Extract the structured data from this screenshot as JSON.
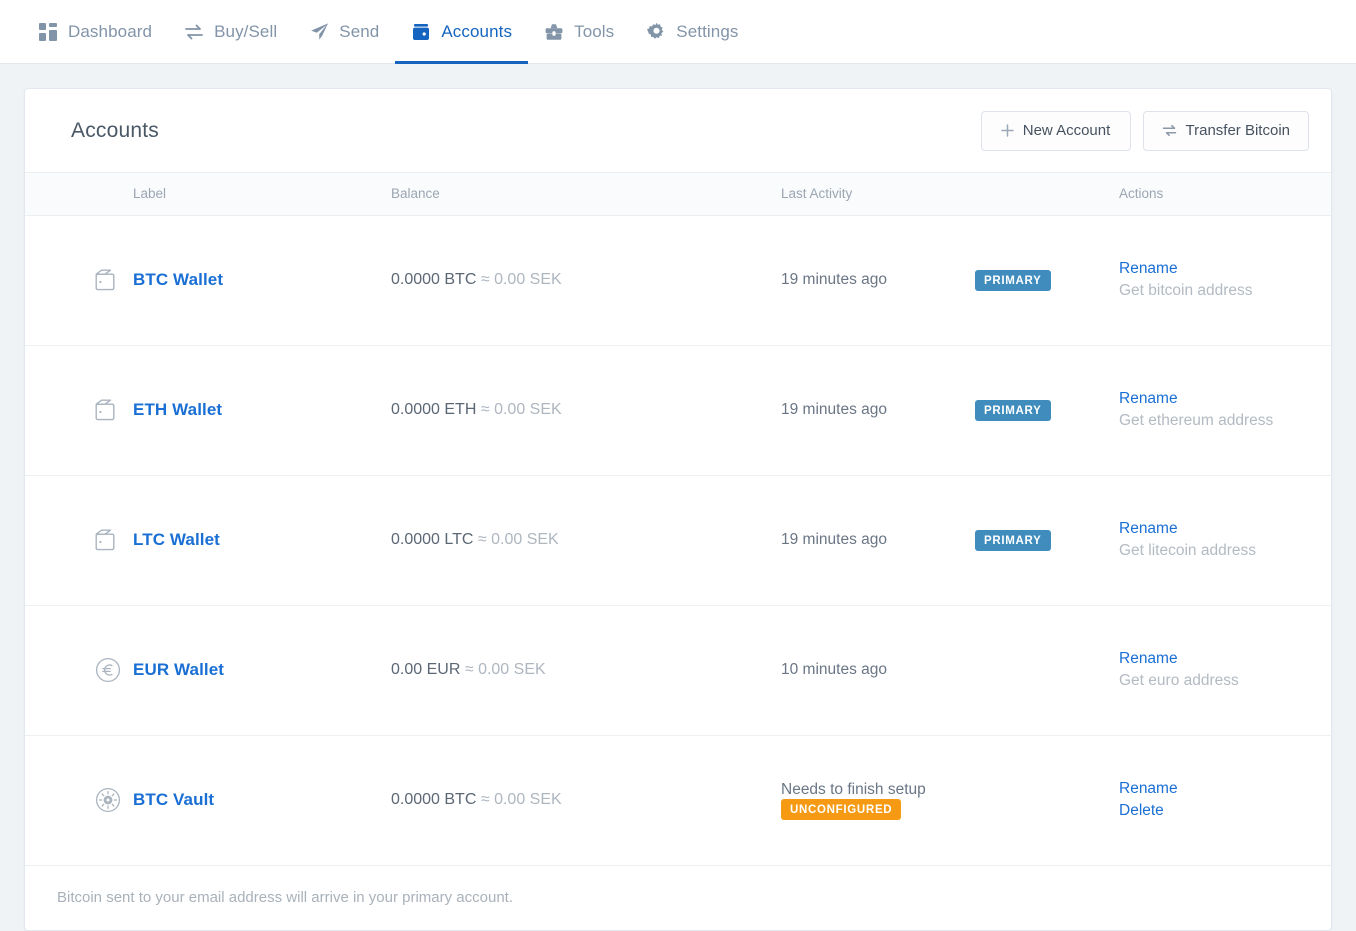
{
  "nav": {
    "items": [
      {
        "label": "Dashboard",
        "icon": "grid-icon",
        "active": false
      },
      {
        "label": "Buy/Sell",
        "icon": "exchange-icon",
        "active": false
      },
      {
        "label": "Send",
        "icon": "paper-plane-icon",
        "active": false
      },
      {
        "label": "Accounts",
        "icon": "wallet-icon",
        "active": true
      },
      {
        "label": "Tools",
        "icon": "toolbox-icon",
        "active": false
      },
      {
        "label": "Settings",
        "icon": "gear-icon",
        "active": false
      }
    ]
  },
  "card": {
    "title": "Accounts",
    "new_account_label": "New Account",
    "new_account_icon": "plus-icon",
    "transfer_label": "Transfer Bitcoin",
    "transfer_icon": "transfer-icon",
    "footer_note": "Bitcoin sent to your email address will arrive in your primary account."
  },
  "table": {
    "headers": {
      "label": "Label",
      "balance": "Balance",
      "last_activity": "Last Activity",
      "actions": "Actions"
    },
    "rows": [
      {
        "icon": "wallet-outline-icon",
        "label": "BTC Wallet",
        "balance_amount": "0.0000 BTC",
        "approx": "≈",
        "balance_fiat": "0.00 SEK",
        "last_activity": "19 minutes ago",
        "badge": "PRIMARY",
        "badge_kind": "primary",
        "action_primary": "Rename",
        "action_secondary": "Get bitcoin address",
        "action_secondary_kind": "muted"
      },
      {
        "icon": "wallet-outline-icon",
        "label": "ETH Wallet",
        "balance_amount": "0.0000 ETH",
        "approx": "≈",
        "balance_fiat": "0.00 SEK",
        "last_activity": "19 minutes ago",
        "badge": "PRIMARY",
        "badge_kind": "primary",
        "action_primary": "Rename",
        "action_secondary": "Get ethereum address",
        "action_secondary_kind": "muted"
      },
      {
        "icon": "wallet-outline-icon",
        "label": "LTC Wallet",
        "balance_amount": "0.0000 LTC",
        "approx": "≈",
        "balance_fiat": "0.00 SEK",
        "last_activity": "19 minutes ago",
        "badge": "PRIMARY",
        "badge_kind": "primary",
        "action_primary": "Rename",
        "action_secondary": "Get litecoin address",
        "action_secondary_kind": "muted"
      },
      {
        "icon": "euro-circle-icon",
        "label": "EUR Wallet",
        "balance_amount": "0.00 EUR",
        "approx": "≈",
        "balance_fiat": "0.00 SEK",
        "last_activity": "10 minutes ago",
        "badge": "",
        "badge_kind": "none",
        "action_primary": "Rename",
        "action_secondary": "Get euro address",
        "action_secondary_kind": "muted"
      },
      {
        "icon": "vault-dial-icon",
        "label": "BTC Vault",
        "balance_amount": "0.0000 BTC",
        "approx": "≈",
        "balance_fiat": "0.00 SEK",
        "last_activity": "Needs to finish setup",
        "badge": "UNCONFIGURED",
        "badge_kind": "unconfigured",
        "action_primary": "Rename",
        "action_secondary": "Delete",
        "action_secondary_kind": "link"
      }
    ]
  },
  "colors": {
    "page_background": "#eff3f6",
    "accent_blue": "#1565c0",
    "link_blue": "#1a6fd4",
    "badge_primary": "#3f8cbd",
    "badge_unconfigured": "#f59a12",
    "nav_inactive": "#8294a8"
  }
}
